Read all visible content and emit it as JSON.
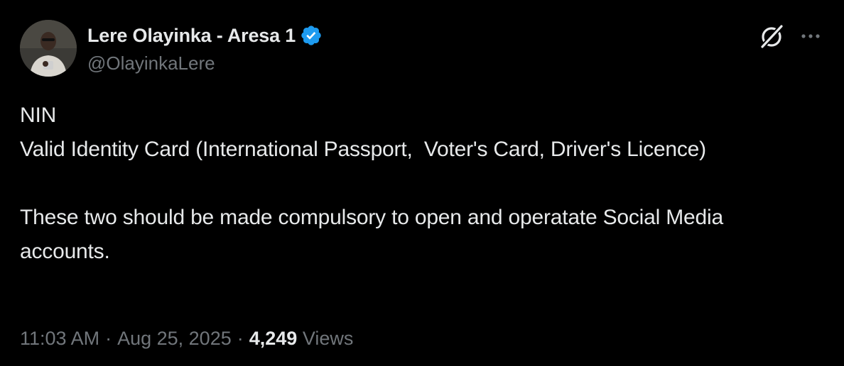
{
  "author": {
    "display_name": "Lere Olayinka - Aresa 1",
    "handle": "@OlayinkaLere",
    "verified": true
  },
  "tweet": {
    "lines": [
      "NIN",
      "Valid Identity Card (International Passport,  Voter's Card, Driver's Licence)",
      "These two should be made compulsory to open and operatate Social Media accounts."
    ]
  },
  "meta": {
    "time": "11:03 AM",
    "separator": "·",
    "date": "Aug 25, 2025",
    "views_count": "4,249",
    "views_label": "Views"
  },
  "icons": {
    "verified": "verified-badge-icon",
    "grok": "grok-icon",
    "more": "more-options-icon"
  },
  "colors": {
    "background": "#000000",
    "text_primary": "#e7e9ea",
    "text_secondary": "#71767b",
    "verified_badge": "#1d9bf0"
  }
}
